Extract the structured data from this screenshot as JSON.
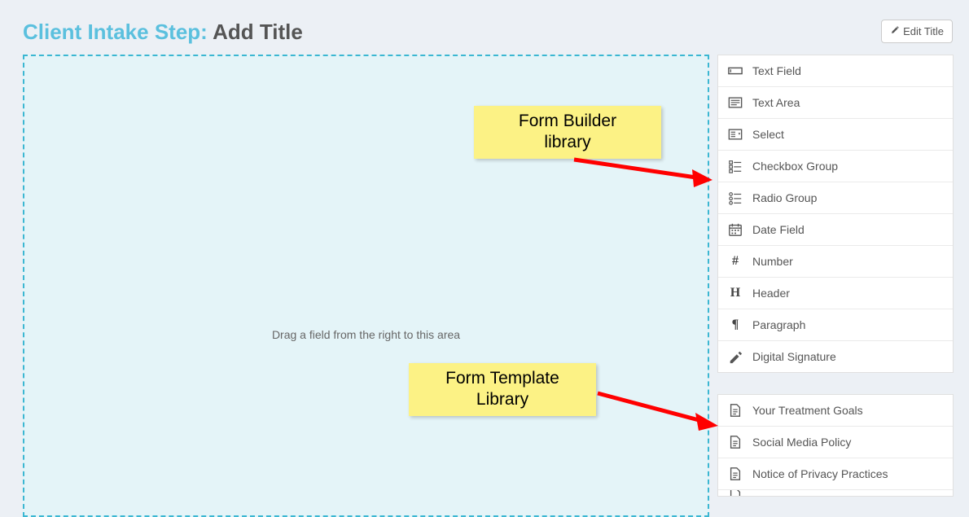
{
  "header": {
    "title_prefix": "Client Intake Step:",
    "title_value": "Add Title",
    "edit_button_label": "Edit Title"
  },
  "canvas": {
    "empty_text": "Drag a field from the right to this area"
  },
  "builder_panel": {
    "items": [
      {
        "icon": "text-field-icon",
        "label": "Text Field"
      },
      {
        "icon": "text-area-icon",
        "label": "Text Area"
      },
      {
        "icon": "select-icon",
        "label": "Select"
      },
      {
        "icon": "checkbox-group-icon",
        "label": "Checkbox Group"
      },
      {
        "icon": "radio-group-icon",
        "label": "Radio Group"
      },
      {
        "icon": "date-field-icon",
        "label": "Date Field"
      },
      {
        "icon": "number-icon",
        "label": "Number"
      },
      {
        "icon": "header-icon",
        "label": "Header"
      },
      {
        "icon": "paragraph-icon",
        "label": "Paragraph"
      },
      {
        "icon": "signature-icon",
        "label": "Digital Signature"
      }
    ]
  },
  "templates_panel": {
    "items": [
      {
        "icon": "document-icon",
        "label": "Your Treatment Goals"
      },
      {
        "icon": "document-icon",
        "label": "Social Media Policy"
      },
      {
        "icon": "document-icon",
        "label": "Notice of Privacy Practices"
      }
    ]
  },
  "annotations": {
    "builder_callout": "Form Builder\nlibrary",
    "templates_callout": "Form Template\nLibrary"
  }
}
